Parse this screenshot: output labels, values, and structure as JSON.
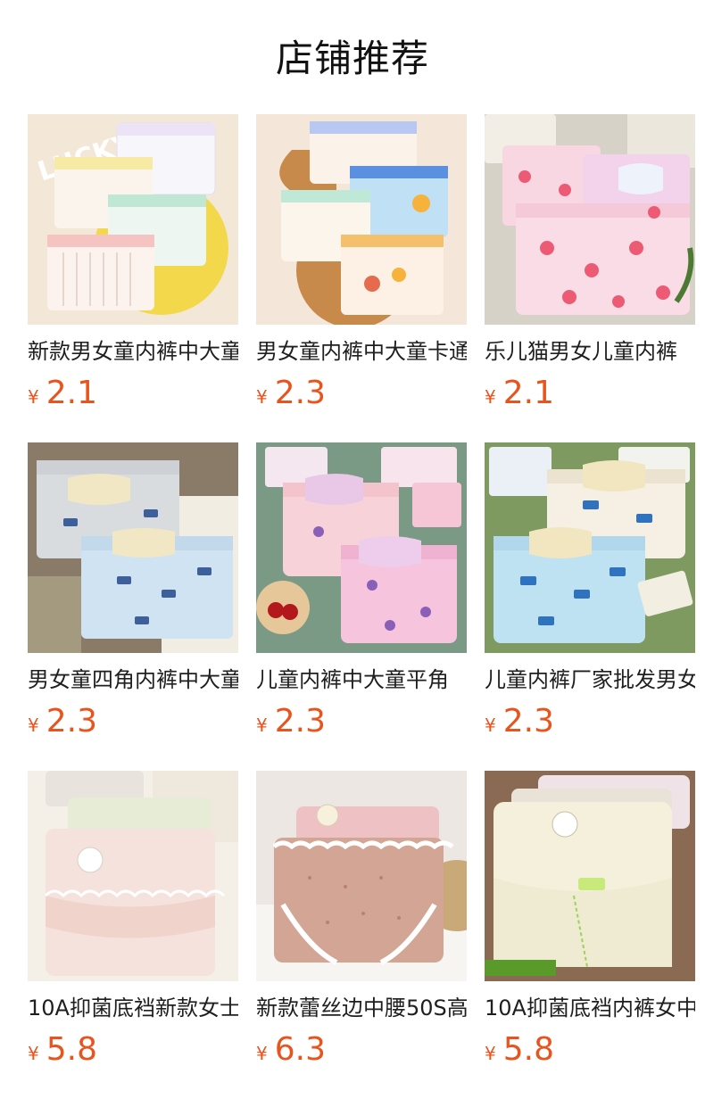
{
  "section": {
    "title": "店铺推荐"
  },
  "currency_symbol": "¥",
  "colors": {
    "price": "#e8541e"
  },
  "products": [
    {
      "name": "新款男女童内裤中大童",
      "price": "2.1",
      "image": "lucky-striped-boxers-photo"
    },
    {
      "name": "男女童内裤中大童卡通",
      "price": "2.3",
      "image": "cartoon-car-boxers-photo"
    },
    {
      "name": "乐儿猫男女儿童内裤",
      "price": "2.1",
      "image": "pink-flower-boxers-photo"
    },
    {
      "name": "男女童四角内裤中大童",
      "price": "2.3",
      "image": "blue-grey-car-boxers-photo"
    },
    {
      "name": "儿童内裤中大童平角",
      "price": "2.3",
      "image": "pink-unicorn-boxers-photo"
    },
    {
      "name": "儿童内裤厂家批发男女",
      "price": "2.3",
      "image": "blue-vehicle-boxers-photo"
    },
    {
      "name": "10A抑菌底裆新款女士",
      "price": "5.8",
      "image": "lace-briefs-cream-photo"
    },
    {
      "name": "新款蕾丝边中腰50S高",
      "price": "6.3",
      "image": "pink-lace-briefs-photo"
    },
    {
      "name": "10A抑菌底裆内裤女中",
      "price": "5.8",
      "image": "seamless-ivory-briefs-photo"
    }
  ]
}
